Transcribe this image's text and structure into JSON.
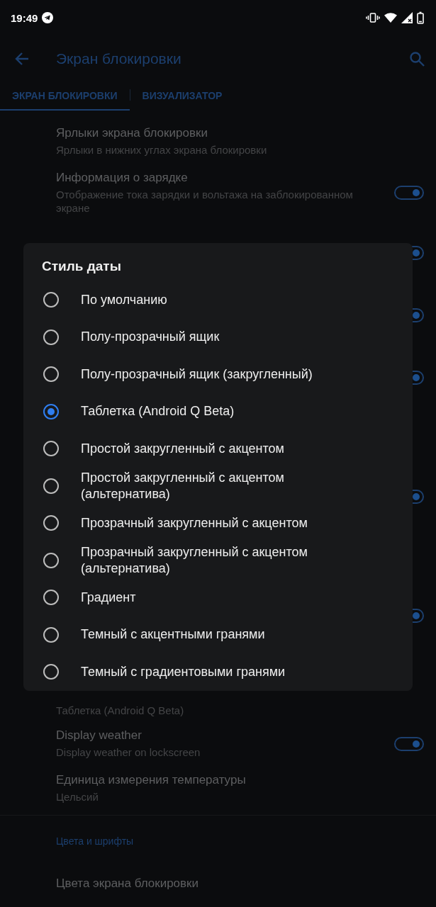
{
  "status_bar": {
    "time": "19:49"
  },
  "toolbar": {
    "title": "Экран блокировки"
  },
  "tabs": [
    {
      "label": "ЭКРАН БЛОКИРОВКИ",
      "selected": true
    },
    {
      "label": "ВИЗУАЛИЗАТОР",
      "selected": false
    }
  ],
  "settings": [
    {
      "kind": "plain",
      "title": "Ярлыки экрана блокировки",
      "summary": "Ярлыки в нижних углах экрана блокировки"
    },
    {
      "kind": "toggle",
      "title": "Информация о зарядке",
      "summary": "Отображение тока зарядки и вольтажа на заблокированном экране",
      "on": true
    },
    {
      "kind": "hidden-toggle",
      "on": true
    },
    {
      "kind": "hidden-toggle",
      "on": true
    },
    {
      "kind": "hidden-toggle",
      "on": true
    },
    {
      "kind": "hidden"
    },
    {
      "kind": "hidden-toggle",
      "on": true
    },
    {
      "kind": "hidden"
    },
    {
      "kind": "hidden-toggle",
      "on": true
    },
    {
      "kind": "summary-only",
      "summary": "Таблетка (Android Q Beta)"
    },
    {
      "kind": "toggle",
      "title": "Display weather",
      "summary": "Display weather on lockscreen",
      "on": true
    },
    {
      "kind": "plain",
      "title": "Единица измерения температуры",
      "summary": "Цельсий"
    },
    {
      "kind": "divider"
    },
    {
      "kind": "header",
      "title": "Цвета и шрифты"
    },
    {
      "kind": "plain",
      "title": "Цвета экрана блокировки"
    }
  ],
  "dialog": {
    "title": "Стиль даты",
    "options": [
      {
        "label": "По умолчанию",
        "selected": false
      },
      {
        "label": "Полу-прозрачный ящик",
        "selected": false
      },
      {
        "label": "Полу-прозрачный ящик (закругленный)",
        "selected": false
      },
      {
        "label": "Таблетка (Android Q Beta)",
        "selected": true
      },
      {
        "label": "Простой закругленный с акцентом",
        "selected": false
      },
      {
        "label": "Простой закругленный с акцентом (альтернатива)",
        "selected": false
      },
      {
        "label": "Прозрачный закругленный с акцентом",
        "selected": false
      },
      {
        "label": "Прозрачный закругленный с акцентом (альтернатива)",
        "selected": false
      },
      {
        "label": "Градиент",
        "selected": false
      },
      {
        "label": "Темный с акцентными гранями",
        "selected": false
      },
      {
        "label": "Темный с градиентовыми гранями",
        "selected": false
      }
    ]
  }
}
